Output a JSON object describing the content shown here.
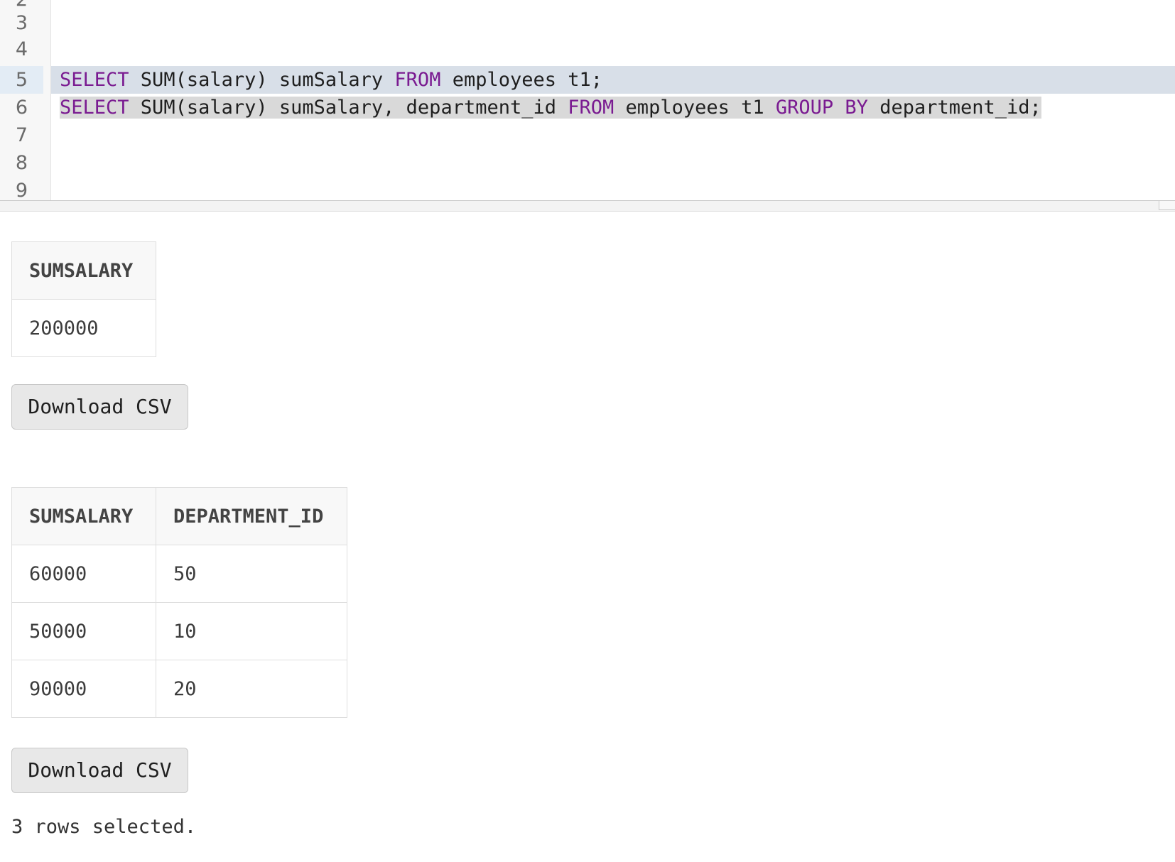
{
  "editor": {
    "line_numbers": [
      "2",
      "3",
      "4",
      "5",
      "6",
      "7",
      "8",
      "9"
    ],
    "active_line": "5",
    "lines": {
      "line5": {
        "kw1": "SELECT",
        "t1": " SUM(salary) sumSalary ",
        "kw2": "FROM",
        "t2": " employees t1;"
      },
      "line6": {
        "kw1": "SELECT",
        "t1": " SUM(salary) sumSalary, department_id ",
        "kw2": "FROM",
        "t2": " employees t1 ",
        "kw3": "GROUP",
        "t3": " ",
        "kw4": "BY",
        "t4": " department_id;"
      }
    }
  },
  "result1": {
    "columns": [
      "SUMSALARY"
    ],
    "rows": [
      [
        "200000"
      ]
    ],
    "download_label": "Download CSV"
  },
  "result2": {
    "columns": [
      "SUMSALARY",
      "DEPARTMENT_ID"
    ],
    "rows": [
      [
        "60000",
        "50"
      ],
      [
        "50000",
        "10"
      ],
      [
        "90000",
        "20"
      ]
    ],
    "download_label": "Download CSV",
    "status": "3 rows selected."
  },
  "colors": {
    "keyword": "#7a1b91",
    "active_line_bg": "#d8dfe8",
    "selection_bg": "#d9d9d9"
  }
}
